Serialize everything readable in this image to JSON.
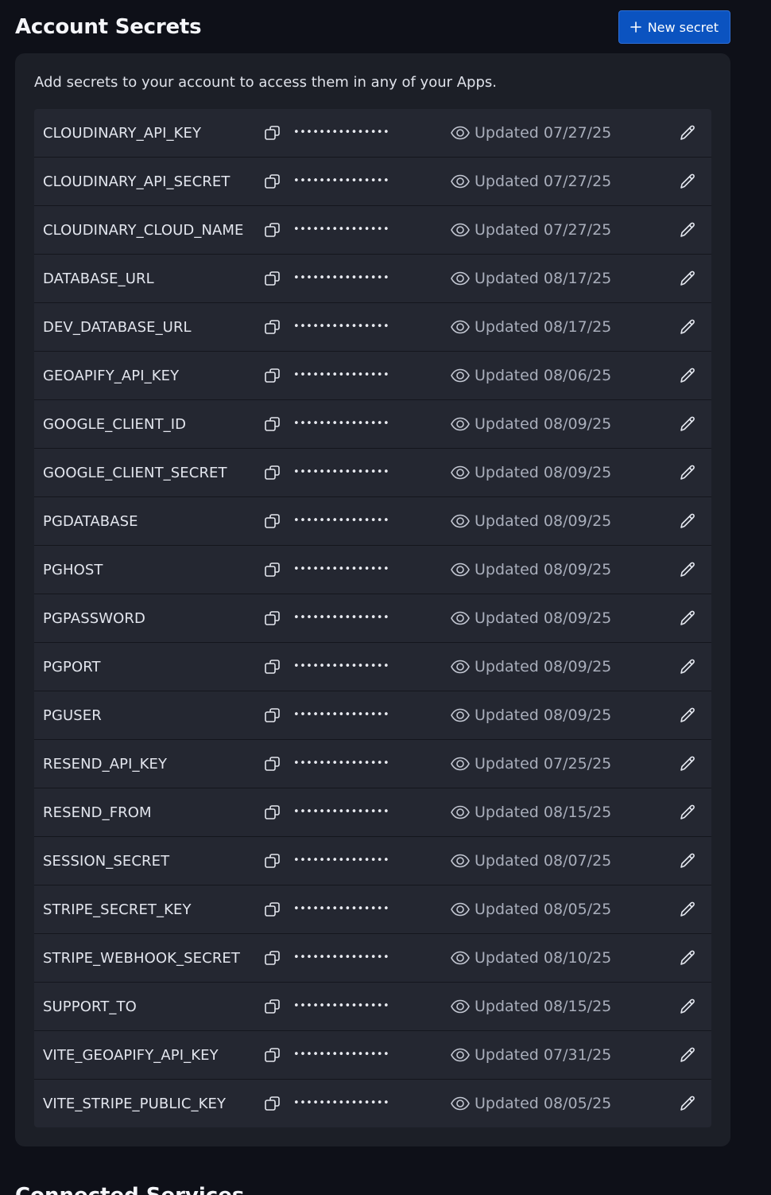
{
  "header": {
    "title": "Account Secrets",
    "new_secret_label": "New secret"
  },
  "card": {
    "description": "Add secrets to your account to access them in any of your Apps."
  },
  "masked_value": "•••••••••••••••",
  "icons": {
    "copy": "copy-icon",
    "reveal": "eye-icon",
    "edit": "pencil-icon",
    "add": "plus-icon"
  },
  "colors": {
    "accent": "#0b53c0",
    "background": "#0e1018",
    "card": "#1c1f27",
    "row": "#242731"
  },
  "secrets": [
    {
      "name": "CLOUDINARY_API_KEY",
      "updated": "Updated 07/27/25"
    },
    {
      "name": "CLOUDINARY_API_SECRET",
      "updated": "Updated 07/27/25"
    },
    {
      "name": "CLOUDINARY_CLOUD_NAME",
      "updated": "Updated 07/27/25"
    },
    {
      "name": "DATABASE_URL",
      "updated": "Updated 08/17/25"
    },
    {
      "name": "DEV_DATABASE_URL",
      "updated": "Updated 08/17/25"
    },
    {
      "name": "GEOAPIFY_API_KEY",
      "updated": "Updated 08/06/25"
    },
    {
      "name": "GOOGLE_CLIENT_ID",
      "updated": "Updated 08/09/25"
    },
    {
      "name": "GOOGLE_CLIENT_SECRET",
      "updated": "Updated 08/09/25"
    },
    {
      "name": "PGDATABASE",
      "updated": "Updated 08/09/25"
    },
    {
      "name": "PGHOST",
      "updated": "Updated 08/09/25"
    },
    {
      "name": "PGPASSWORD",
      "updated": "Updated 08/09/25"
    },
    {
      "name": "PGPORT",
      "updated": "Updated 08/09/25"
    },
    {
      "name": "PGUSER",
      "updated": "Updated 08/09/25"
    },
    {
      "name": "RESEND_API_KEY",
      "updated": "Updated 07/25/25"
    },
    {
      "name": "RESEND_FROM",
      "updated": "Updated 08/15/25"
    },
    {
      "name": "SESSION_SECRET",
      "updated": "Updated 08/07/25"
    },
    {
      "name": "STRIPE_SECRET_KEY",
      "updated": "Updated 08/05/25"
    },
    {
      "name": "STRIPE_WEBHOOK_SECRET",
      "updated": "Updated 08/10/25"
    },
    {
      "name": "SUPPORT_TO",
      "updated": "Updated 08/15/25"
    },
    {
      "name": "VITE_GEOAPIFY_API_KEY",
      "updated": "Updated 07/31/25"
    },
    {
      "name": "VITE_STRIPE_PUBLIC_KEY",
      "updated": "Updated 08/05/25"
    }
  ],
  "next_section": {
    "title": "Connected Services"
  }
}
